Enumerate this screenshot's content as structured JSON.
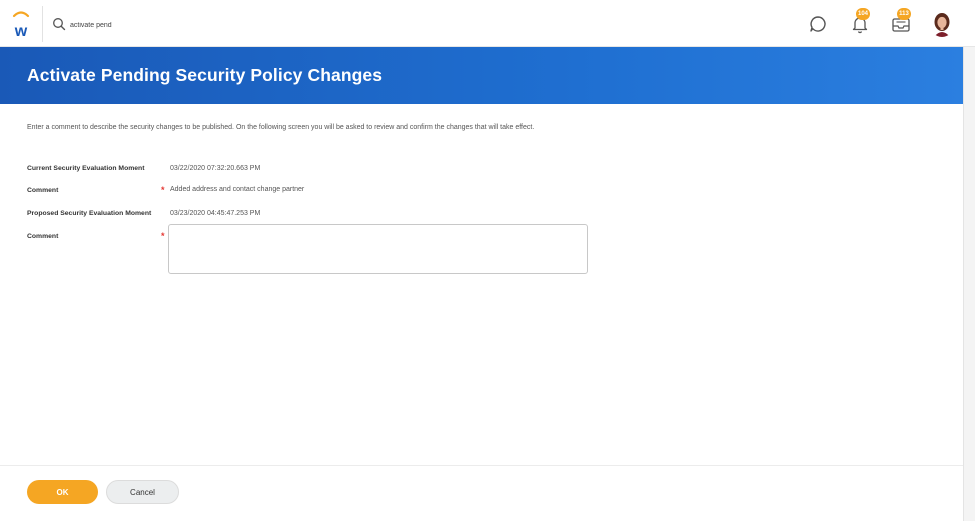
{
  "header": {
    "search_value": "activate pend",
    "notifications_badge": "104",
    "inbox_badge": "113",
    "icons": [
      "workday-logo-icon",
      "search-icon",
      "chat-icon",
      "bell-icon",
      "inbox-icon",
      "avatar"
    ]
  },
  "page": {
    "title": "Activate Pending Security Policy Changes",
    "description": "Enter a comment to describe the security changes to be published. On the following screen you will be asked to review and confirm the changes that will take effect."
  },
  "form": {
    "current_moment_label": "Current Security Evaluation Moment",
    "current_moment_value": "03/22/2020 07:32:20.663 PM",
    "comment1_label": "Comment",
    "comment1_value": "Added address and contact change partner",
    "proposed_moment_label": "Proposed Security Evaluation Moment",
    "proposed_moment_value": "03/23/2020 04:45:47.253 PM",
    "comment2_label": "Comment",
    "comment2_value": "",
    "required_marker": "*"
  },
  "footer": {
    "ok_label": "OK",
    "cancel_label": "Cancel"
  },
  "colors": {
    "brand_blue": "#1f6fd1",
    "accent_orange": "#f5a623",
    "required_red": "#e53935"
  }
}
